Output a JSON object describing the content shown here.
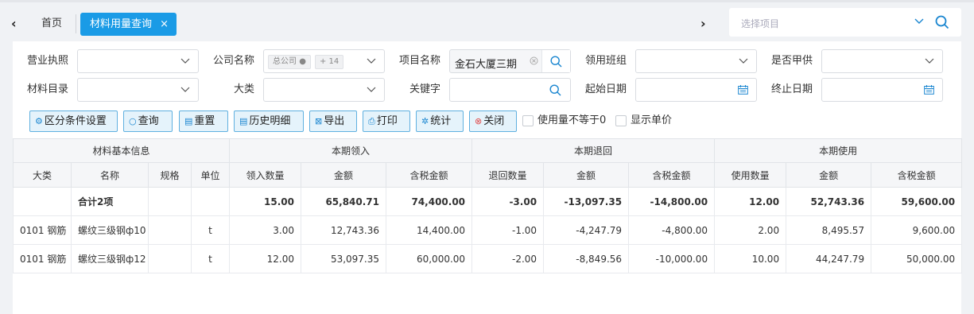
{
  "topbar": {
    "left_arrow": "‹",
    "right_arrow": "›",
    "home_tab": "首页",
    "active_tab": "材料用量查询",
    "close_glyph": "×",
    "project_placeholder": "选择项目"
  },
  "filters": {
    "business_license": {
      "label": "营业执照",
      "value": ""
    },
    "company_name": {
      "label": "公司名称",
      "chip1": "总公司",
      "chip2": "+ 14"
    },
    "project_name": {
      "label": "项目名称",
      "value": "金石大厦三期"
    },
    "team": {
      "label": "领用班组",
      "value": ""
    },
    "party_a_supply": {
      "label": "是否甲供",
      "value": ""
    },
    "material_catalog": {
      "label": "材料目录",
      "value": ""
    },
    "category": {
      "label": "大类",
      "value": ""
    },
    "keyword": {
      "label": "关键字",
      "value": ""
    },
    "start_date": {
      "label": "起始日期",
      "value": ""
    },
    "end_date": {
      "label": "终止日期",
      "value": ""
    }
  },
  "toolbar": {
    "split_settings": "区分条件设置",
    "query": "查询",
    "reset": "重置",
    "history": "历史明细",
    "export": "导出",
    "print": "打印",
    "stats": "统计",
    "close": "关闭",
    "chk_usage_ne_zero": "使用量不等于0",
    "chk_show_price": "显示单价"
  },
  "table": {
    "groups": [
      "材料基本信息",
      "本期领入",
      "本期退回",
      "本期使用"
    ],
    "columns": [
      "大类",
      "名称",
      "规格",
      "单位",
      "领入数量",
      "金额",
      "含税金额",
      "退回数量",
      "金额",
      "含税金额",
      "使用数量",
      "金额",
      "含税金额"
    ],
    "total": [
      "",
      "合计2项",
      "",
      "",
      "15.00",
      "65,840.71",
      "74,400.00",
      "-3.00",
      "-13,097.35",
      "-14,800.00",
      "12.00",
      "52,743.36",
      "59,600.00"
    ],
    "rows": [
      [
        "0101 钢筋",
        "螺纹三级钢ф10",
        "",
        "t",
        "3.00",
        "12,743.36",
        "14,400.00",
        "-1.00",
        "-4,247.79",
        "-4,800.00",
        "2.00",
        "8,495.57",
        "9,600.00"
      ],
      [
        "0101 钢筋",
        "螺纹三级钢ф12",
        "",
        "t",
        "12.00",
        "53,097.35",
        "60,000.00",
        "-2.00",
        "-8,849.56",
        "-10,000.00",
        "10.00",
        "44,247.79",
        "50,000.00"
      ]
    ]
  },
  "colors": {
    "accent": "#1a9be6",
    "button_bg": "#e5f3fb",
    "button_border": "#5fb0e0"
  }
}
